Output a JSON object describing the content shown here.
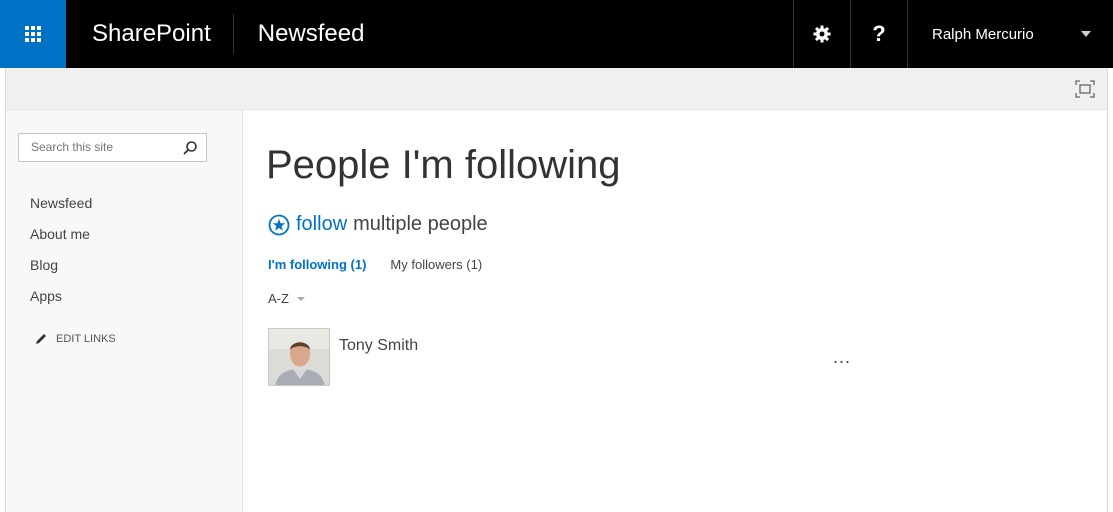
{
  "suitebar": {
    "brand": "SharePoint",
    "app_title": "Newsfeed",
    "user_name": "Ralph Mercurio",
    "help_label": "?"
  },
  "search": {
    "placeholder": "Search this site"
  },
  "nav": {
    "items": [
      "Newsfeed",
      "About me",
      "Blog",
      "Apps"
    ],
    "edit_links": "EDIT LINKS"
  },
  "main": {
    "title": "People I'm following",
    "follow_link": "follow",
    "follow_rest": "multiple people",
    "tabs": {
      "following": "I'm following (1)",
      "followers": "My followers (1)"
    },
    "sort_label": "A-Z",
    "people": [
      {
        "name": "Tony Smith",
        "more": "..."
      }
    ]
  },
  "colors": {
    "accent": "#0072c6",
    "suitebar": "#000000"
  },
  "icons": {
    "waffle": "app-launcher-icon",
    "settings": "gear-icon",
    "search": "search-icon",
    "edit": "pencil-icon",
    "focus": "focus-on-content-icon",
    "follow": "star-circle-icon"
  }
}
